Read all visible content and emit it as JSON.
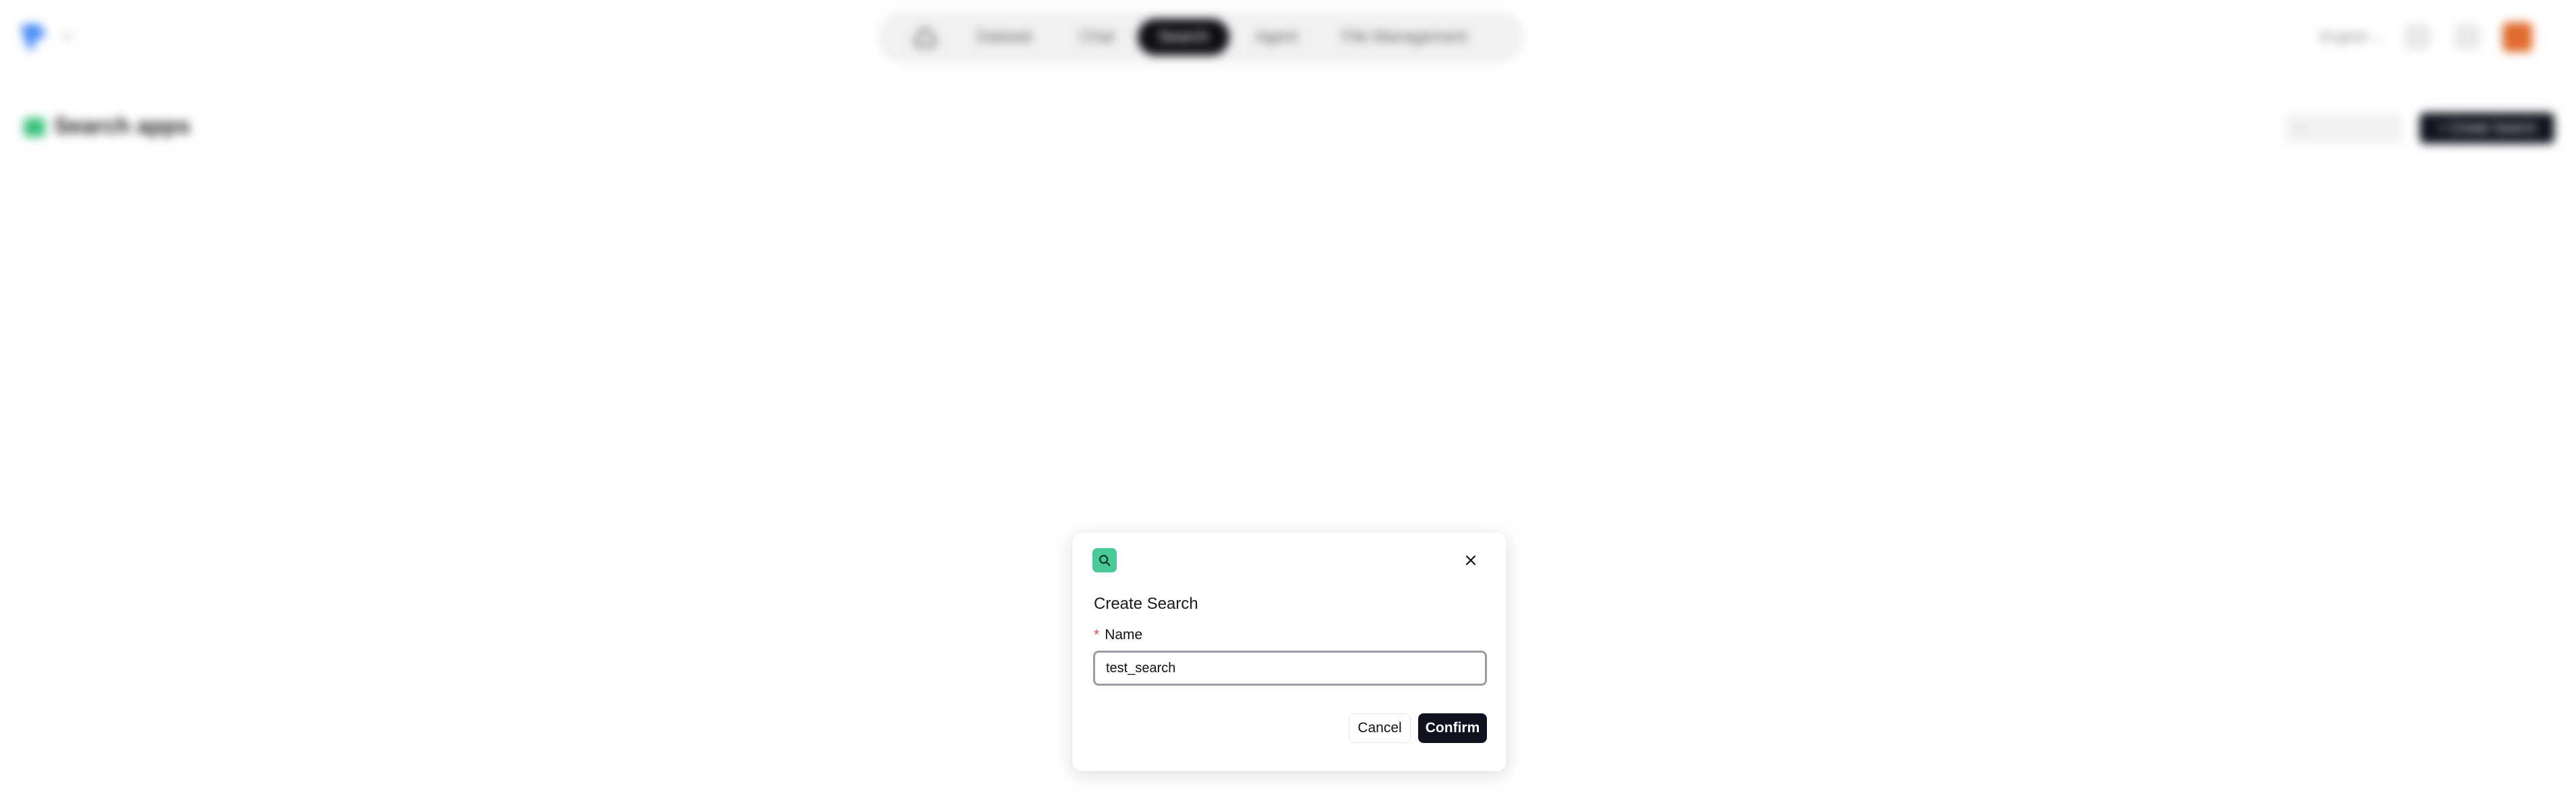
{
  "header": {
    "nav": {
      "home_icon": "home-icon",
      "dataset_label": "Dataset",
      "chat_label": "Chat",
      "search_label": "Search",
      "agent_label": "Agent",
      "files_label": "File Management"
    },
    "language": "English"
  },
  "page": {
    "title": "Search apps",
    "create_label": "Create Search"
  },
  "modal": {
    "title": "Create Search",
    "field_label": "Name",
    "required_mark": "*",
    "name_value": "test_search",
    "cancel_label": "Cancel",
    "confirm_label": "Confirm"
  },
  "colors": {
    "accent_dark": "#10131f",
    "modal_icon_green": "#49c996",
    "avatar_orange": "#e06b2e",
    "required_red": "#e5484d"
  }
}
